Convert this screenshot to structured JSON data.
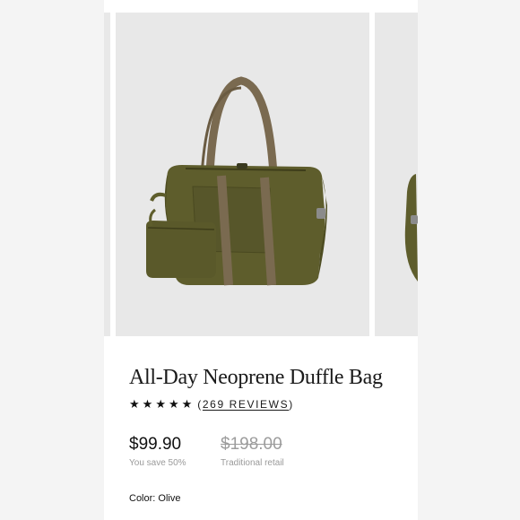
{
  "product": {
    "title": "All-Day Neoprene Duffle Bag",
    "rating": {
      "stars": 5,
      "star_glyph": "★",
      "reviews_open": "(",
      "reviews_link": "269 REVIEWS",
      "reviews_close": ")"
    },
    "price": "$99.90",
    "savings": "You save 50%",
    "retail_price": "$198.00",
    "retail_label": "Traditional retail",
    "color_label": "Color: Olive"
  },
  "colors": {
    "page_bg": "#f4f4f4",
    "card_bg": "#ffffff",
    "image_bg": "#e8e8e8",
    "bag_olive": "#5e5d2c",
    "strap_brown": "#7a6a50"
  },
  "gallery": {
    "images": [
      "duffle-bag-olive-main",
      "duffle-bag-olive-next"
    ]
  }
}
